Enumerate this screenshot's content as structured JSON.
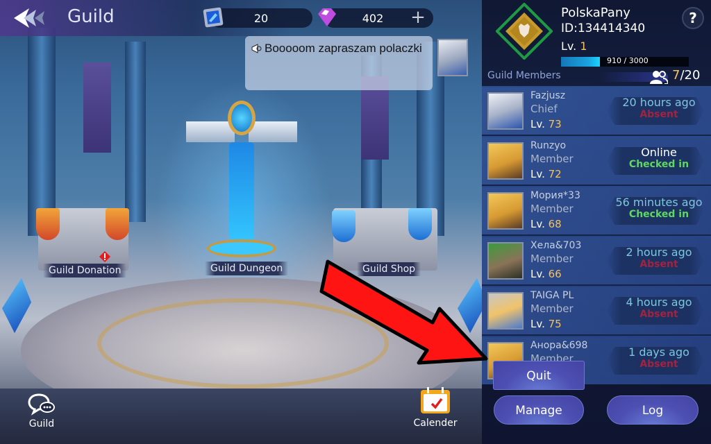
{
  "header": {
    "title": "Guild",
    "back_icon": "back-arrow-icon"
  },
  "currencies": [
    {
      "icon": "blue-crystal-icon",
      "value": "20"
    },
    {
      "icon": "purple-gem-icon",
      "value": "402",
      "add_label": "+"
    }
  ],
  "chat": {
    "icon": "megaphone-icon",
    "message": "Booooom zapraszam polaczki"
  },
  "facilities": [
    {
      "label": "Guild Donation",
      "alert": true
    },
    {
      "label": "Guild Dungeon"
    },
    {
      "label": "Guild Shop"
    }
  ],
  "bottom_nav": [
    {
      "label": "Guild",
      "icon": "chat-bubbles-icon"
    },
    {
      "label": "Calender",
      "icon": "calendar-icon"
    }
  ],
  "guild": {
    "name": "PolskaPany",
    "id": "ID:134414340",
    "level_prefix": "Lv.",
    "level": "1",
    "xp_text": "910 / 3000",
    "xp_current": 910,
    "xp_max": 3000,
    "help_label": "?"
  },
  "members_section": {
    "title": "Guild Members",
    "count_current": "7",
    "count_sep_max": "/20"
  },
  "members": [
    {
      "name": "Fazjusz",
      "role": "Chief",
      "level": "73",
      "last_seen": "20 hours  ago",
      "status": "Absent",
      "status_type": "absent"
    },
    {
      "name": "Runzyo",
      "role": "Member",
      "level": "72",
      "last_seen": "Online",
      "status": "Checked in",
      "status_type": "checked"
    },
    {
      "name": "Мория*33",
      "role": "Member",
      "level": "68",
      "last_seen": "56 minutes  ago",
      "status": "Checked in",
      "status_type": "checked"
    },
    {
      "name": "Хела&703",
      "role": "Member",
      "level": "66",
      "last_seen": "2 hours  ago",
      "status": "Absent",
      "status_type": "absent"
    },
    {
      "name": "TAIGA PL",
      "role": "Member",
      "level": "75",
      "last_seen": "4 hours  ago",
      "status": "Absent",
      "status_type": "absent"
    },
    {
      "name": "Анора&698",
      "role": "Member",
      "level": "",
      "last_seen": "1 days  ago",
      "status": "Absent",
      "status_type": "absent"
    }
  ],
  "actions": {
    "quit": "Quit",
    "manage": "Manage",
    "log": "Log"
  },
  "colors": {
    "accent_gold": "#f6c35f",
    "absent_red": "#a8213c",
    "checked_green": "#5fd85f",
    "button_purple": "#4d50b2",
    "annotation_arrow": "#ff1111"
  }
}
